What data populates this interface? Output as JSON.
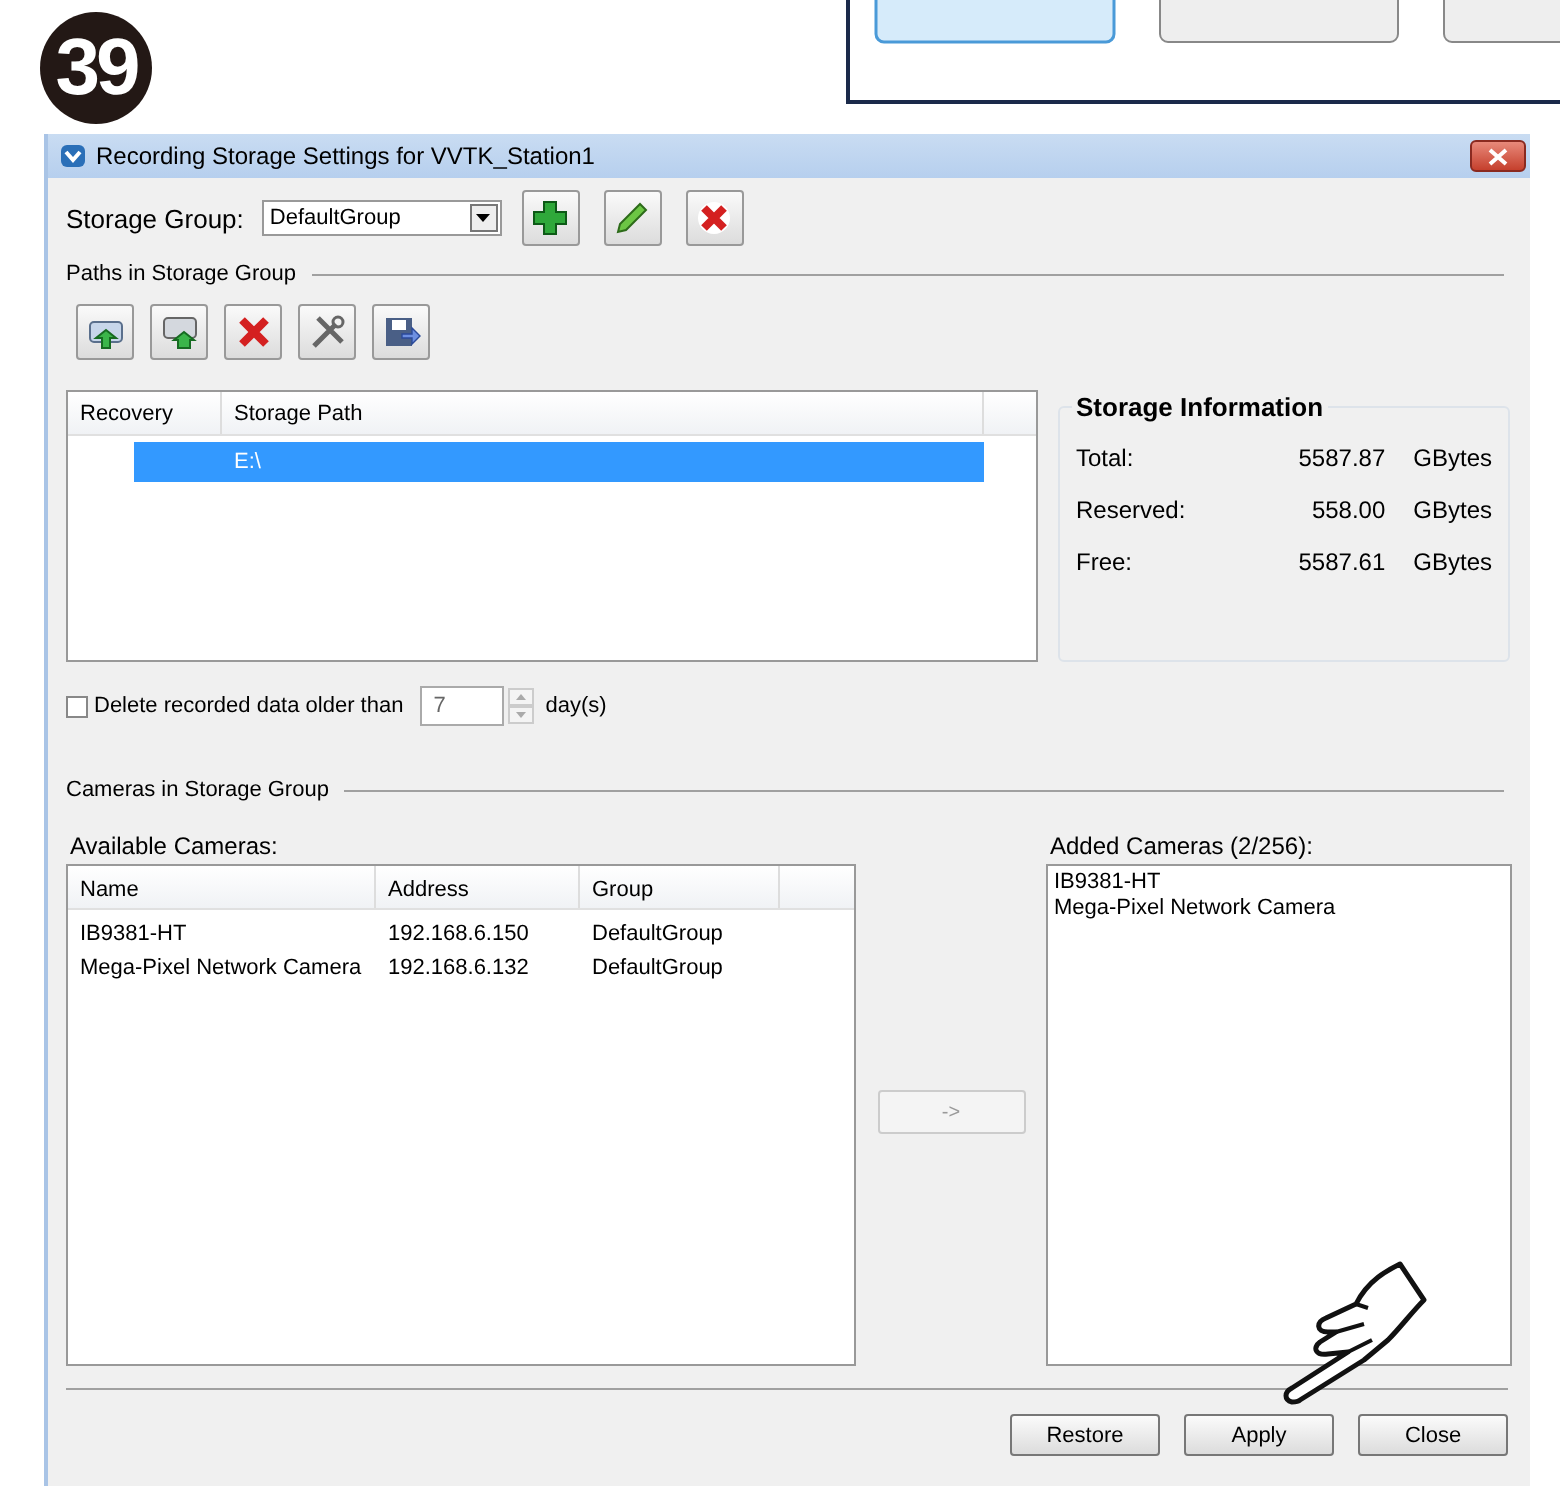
{
  "step_number": "39",
  "window": {
    "title": "Recording Storage Settings for VVTK_Station1"
  },
  "storage_group": {
    "label": "Storage Group:",
    "value": "DefaultGroup"
  },
  "paths_section": {
    "title": "Paths in Storage Group"
  },
  "paths_table": {
    "columns": [
      "Recovery",
      "Storage Path"
    ],
    "rows": [
      {
        "path": "E:\\",
        "selected": true
      }
    ]
  },
  "storage_information": {
    "title": "Storage Information",
    "rows": [
      {
        "label": "Total:",
        "value": "5587.87",
        "unit": "GBytes"
      },
      {
        "label": "Reserved:",
        "value": "558.00",
        "unit": "GBytes"
      },
      {
        "label": "Free:",
        "value": "5587.61",
        "unit": "GBytes"
      }
    ]
  },
  "delete_old": {
    "checked": false,
    "label": "Delete recorded data older than",
    "days": "7",
    "unit": "day(s)"
  },
  "cameras_section": {
    "title": "Cameras in Storage Group"
  },
  "available_cameras": {
    "title": "Available Cameras:",
    "columns": [
      "Name",
      "Address",
      "Group"
    ],
    "rows": [
      {
        "name": "IB9381-HT",
        "address": "192.168.6.150",
        "group": "DefaultGroup"
      },
      {
        "name": "Mega-Pixel Network Camera",
        "address": "192.168.6.132",
        "group": "DefaultGroup"
      }
    ]
  },
  "move_button": {
    "label": "->",
    "disabled": true
  },
  "added_cameras": {
    "title": "Added Cameras (2/256):",
    "items": [
      "IB9381-HT",
      "Mega-Pixel Network Camera"
    ]
  },
  "buttons": [
    "Restore",
    "Apply",
    "Close"
  ]
}
